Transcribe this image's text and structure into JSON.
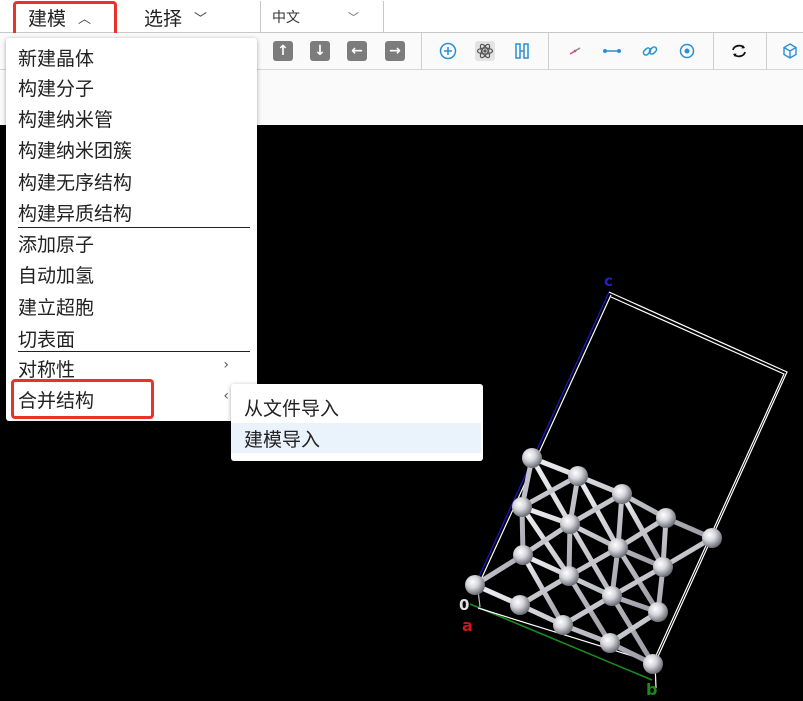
{
  "menubar": {
    "build_label": "建模",
    "select_label": "选择",
    "language_value": "中文"
  },
  "dropdown": {
    "items": [
      "新建晶体",
      "构建分子",
      "构建纳米管",
      "构建纳米团簇",
      "构建无序结构",
      "构建异质结构",
      "添加原子",
      "自动加氢",
      "建立超胞",
      "切表面",
      "对称性",
      "合并结构"
    ]
  },
  "submenu": {
    "items": [
      "从文件导入",
      "建模导入"
    ],
    "highlighted_index": 1
  },
  "viewport": {
    "axis_a": "a",
    "axis_b": "b",
    "axis_c": "c",
    "origin": "0"
  },
  "colors": {
    "highlight_box": "#e8322a",
    "axis_a": "#d0161b",
    "axis_b": "#1d8a1d",
    "axis_c": "#2020c8",
    "icon_blue": "#2b8fd6"
  },
  "toolbar_icons": [
    "arrow-up-icon",
    "arrow-down-icon",
    "arrow-left-icon",
    "arrow-right-icon",
    "add-atom-icon",
    "atom-icon",
    "ruler-icon",
    "bond-split-icon",
    "distance-icon",
    "link-icon",
    "rotate-icon",
    "cycle-icon",
    "cube-icon"
  ]
}
